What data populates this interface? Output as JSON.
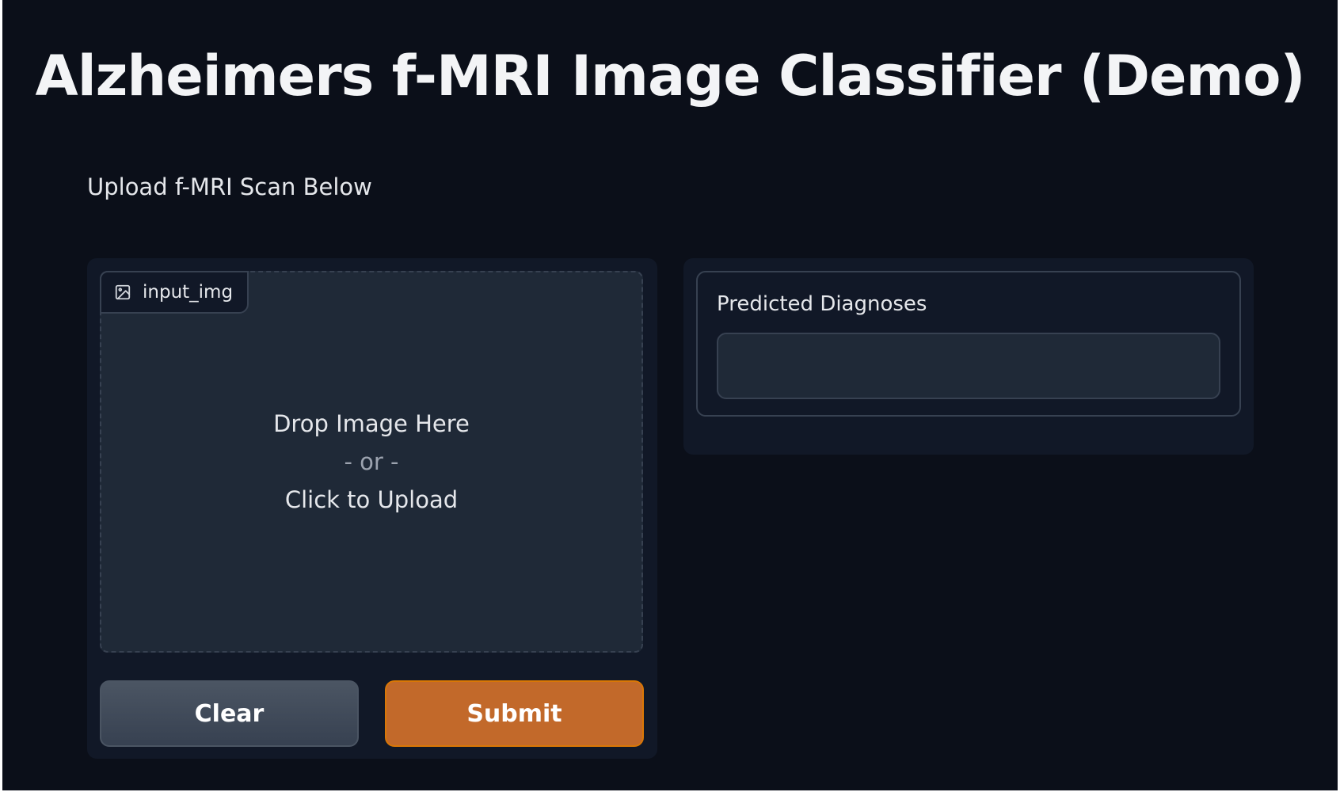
{
  "app": {
    "title": "Alzheimers f-MRI Image Classifier (Demo)",
    "description": "Upload f-MRI Scan Below"
  },
  "input": {
    "label": "input_img",
    "label_icon": "image-icon",
    "drop_line1": "Drop Image Here",
    "drop_or": "- or -",
    "drop_line2": "Click to Upload"
  },
  "buttons": {
    "clear_label": "Clear",
    "submit_label": "Submit"
  },
  "output": {
    "label": "Predicted Diagnoses",
    "value": ""
  },
  "colors": {
    "background": "#0b0f19",
    "panel": "#111827",
    "field": "#1f2937",
    "border": "#374151",
    "submit": "#c2692a",
    "clear": "#4b5563"
  }
}
